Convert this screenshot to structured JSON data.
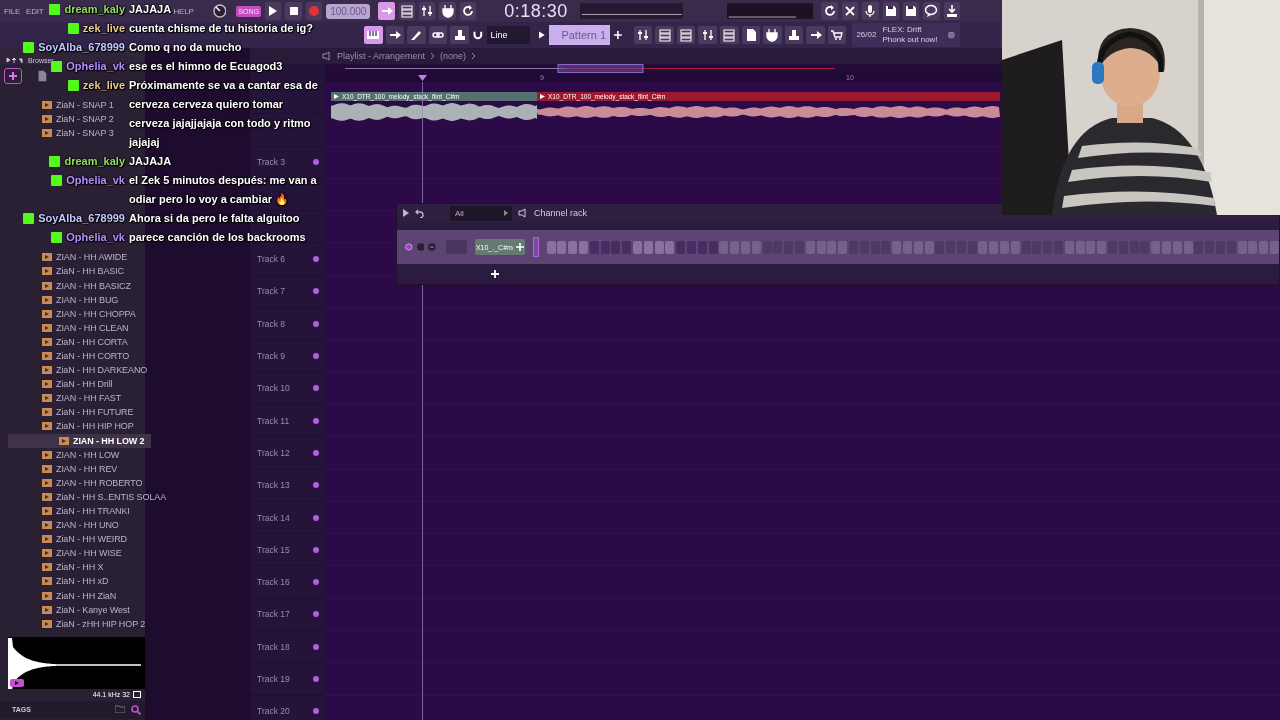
{
  "menu": [
    "FILE",
    "EDIT",
    "HELP"
  ],
  "transport": {
    "mode": "SONG",
    "tempo": "100.000",
    "time": "0:18:30"
  },
  "snap": "Line",
  "pattern": "Pattern 1",
  "news": {
    "date": "26/02",
    "text": "FLEX: Drift Phonk out now!"
  },
  "browser": {
    "title": "Browser",
    "top_items": [
      "ZiaN - SNAP 1",
      "ZiaN - SNAP 2",
      "ZiaN - SNAP 3"
    ],
    "items": [
      {
        "label": "ZIAN - HH AWIDE",
        "selected": false
      },
      {
        "label": "ZiaN - HH BASIC",
        "selected": false
      },
      {
        "label": "ZIAN - HH BASICZ",
        "selected": false
      },
      {
        "label": "ZIAN - HH BUG",
        "selected": false
      },
      {
        "label": "ZIAN - HH CHOPPA",
        "selected": false
      },
      {
        "label": "ZIAN - HH CLEAN",
        "selected": false
      },
      {
        "label": "ZiaN - HH CORTA",
        "selected": false
      },
      {
        "label": "ZiaN - HH CORTO",
        "selected": false
      },
      {
        "label": "ZiaN - HH DARKEANO",
        "selected": false
      },
      {
        "label": "ZiaN - HH Drill",
        "selected": false
      },
      {
        "label": "ZIAN - HH FAST",
        "selected": false
      },
      {
        "label": "ZiaN - HH FUTURE",
        "selected": false
      },
      {
        "label": "ZiaN - HH HIP HOP",
        "selected": false
      },
      {
        "label": "ZIAN - HH LOW 2",
        "selected": true
      },
      {
        "label": "ZIAN - HH LOW",
        "selected": false
      },
      {
        "label": "ZIAN - HH REV",
        "selected": false
      },
      {
        "label": "ZIAN - HH ROBERTO",
        "selected": false
      },
      {
        "label": "ZiaN - HH S..ENTIS SOLAA",
        "selected": false
      },
      {
        "label": "ZiaN - HH TRANKI",
        "selected": false
      },
      {
        "label": "ZIAN - HH UNO",
        "selected": false
      },
      {
        "label": "ZiaN - HH WEIRD",
        "selected": false
      },
      {
        "label": "ZIAN - HH WISE",
        "selected": false
      },
      {
        "label": "ZiaN - HH X",
        "selected": false
      },
      {
        "label": "ZiaN - HH xD",
        "selected": false
      },
      {
        "label": "ZiaN - HH ZiaN",
        "selected": false
      },
      {
        "label": "ZiaN - Kanye West",
        "selected": false
      },
      {
        "label": "ZiaN - zHH HIP HOP 2",
        "selected": false
      }
    ],
    "sample_rate": "44.1 kHz 32",
    "tags_label": "TAGS"
  },
  "playlist": {
    "title": "Playlist - Arrangement",
    "pattern": "(none)",
    "ruler": [
      "9",
      "10"
    ],
    "clips": [
      {
        "name": "X10_DTR_100_melody_stack_flint_C#m",
        "color": "#56706f"
      },
      {
        "name": "X10_DTR_100_melody_stack_flint_C#m",
        "color": "#9c1a2e"
      }
    ],
    "tracks": [
      "Track 3",
      "Track 6",
      "Track 7",
      "Track 8",
      "Track 9",
      "Track 10",
      "Track 11",
      "Track 12",
      "Track 13",
      "Track 14",
      "Track 15",
      "Track 16",
      "Track 17",
      "Track 18",
      "Track 19",
      "Track 20"
    ]
  },
  "channel_rack": {
    "title": "Channel rack",
    "filter": "All",
    "channels": [
      {
        "name": "X10_._C#m"
      }
    ]
  },
  "chat": [
    {
      "user": "dream_kaly",
      "color": "#8de05a",
      "text": "JAJAJA"
    },
    {
      "user": "zek_live",
      "color": "#e6cf8a",
      "text": "cuenta chisme de tu historia de ig?"
    },
    {
      "user": "SoyAlba_678999",
      "color": "#c3c6ff",
      "text": "Como q no da mucho"
    },
    {
      "user": "Ophelia_vk",
      "color": "#b58cff",
      "text": "ese es el himno de Ecuagod3"
    },
    {
      "user": "zek_live",
      "color": "#e6cf8a",
      "text": "Próximamente se va a cantar esa de cerveza cerveza quiero tomar cerveza jajajjajaja con todo y ritmo jajajaj"
    },
    {
      "user": "dream_kaly",
      "color": "#8de05a",
      "text": "JAJAJA"
    },
    {
      "user": "Ophelia_vk",
      "color": "#b58cff",
      "text": "el Zek 5 minutos después: me van a odiar pero lo voy a cambiar 🔥"
    },
    {
      "user": "SoyAlba_678999",
      "color": "#c3c6ff",
      "text": "Ahora si da pero le falta alguitoo"
    },
    {
      "user": "Ophelia_vk",
      "color": "#b58cff",
      "text": "parece canción de los backrooms"
    }
  ]
}
